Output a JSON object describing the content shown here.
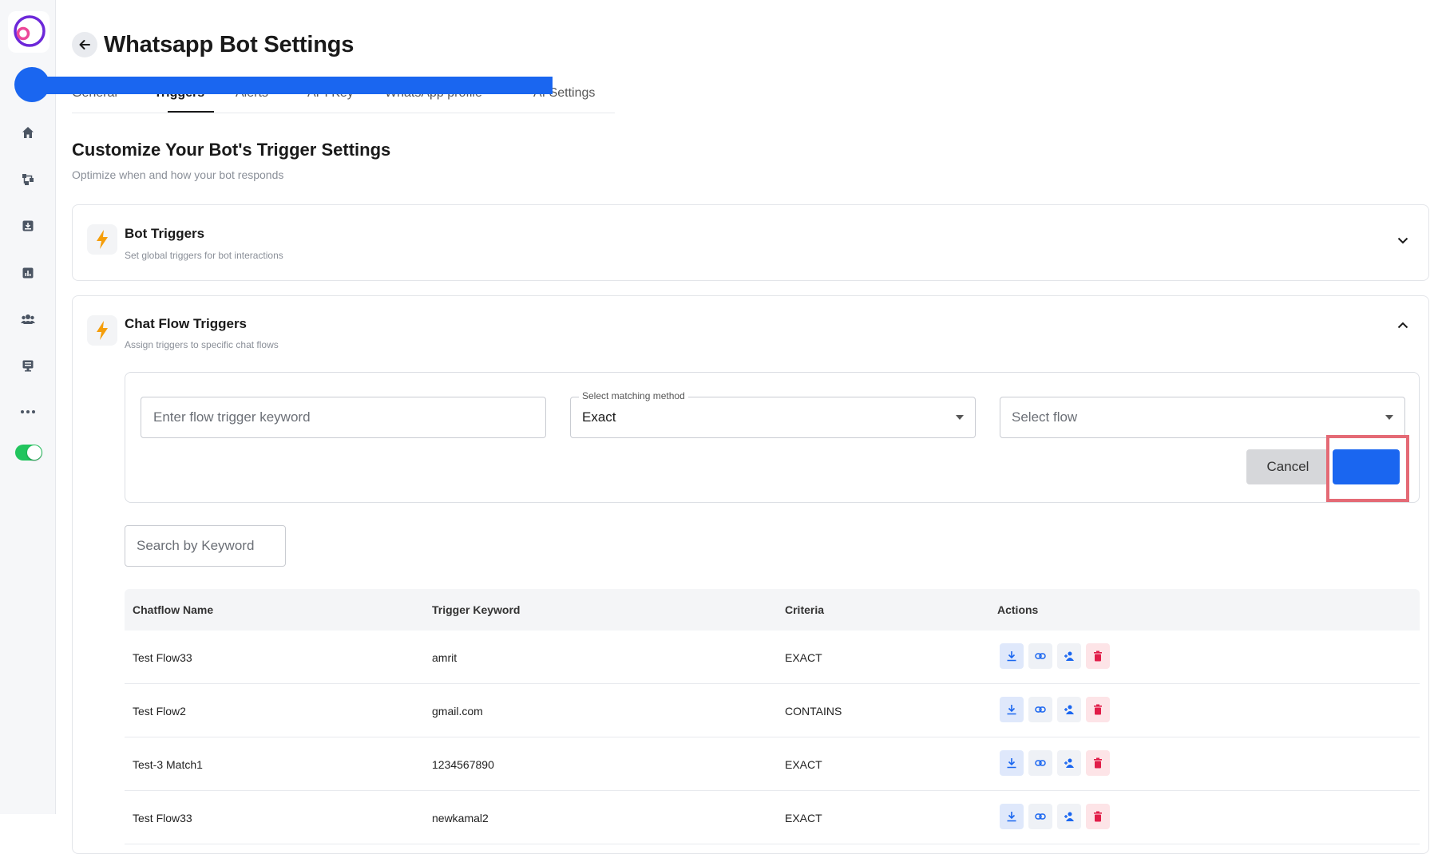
{
  "page": {
    "title": "Whatsapp Bot Settings"
  },
  "tabs": [
    {
      "label": "General"
    },
    {
      "label": "Triggers"
    },
    {
      "label": "Alerts"
    },
    {
      "label": "API Key"
    },
    {
      "label": "WhatsApp profile"
    },
    {
      "label": "AI Settings"
    }
  ],
  "section": {
    "title": "Customize Your Bot's Trigger Settings",
    "subtitle": "Optimize when and how your bot responds"
  },
  "bot_triggers": {
    "title": "Bot Triggers",
    "subtitle": "Set global triggers for bot interactions"
  },
  "chat_flow_triggers": {
    "title": "Chat Flow Triggers",
    "subtitle": "Assign triggers to specific chat flows"
  },
  "form": {
    "keyword_placeholder": "Enter flow trigger keyword",
    "method_legend": "Select matching method",
    "method_value": "Exact",
    "flow_placeholder": "Select flow",
    "cancel_label": "Cancel",
    "save_label": ""
  },
  "search": {
    "placeholder": "Search by Keyword"
  },
  "table": {
    "headers": [
      "Chatflow Name",
      "Trigger Keyword",
      "Criteria",
      "Actions"
    ],
    "rows": [
      {
        "name": "Test Flow33",
        "keyword": "amrit",
        "criteria": "EXACT"
      },
      {
        "name": "Test Flow2",
        "keyword": "gmail.com",
        "criteria": "CONTAINS"
      },
      {
        "name": "Test-3 Match1",
        "keyword": "1234567890",
        "criteria": "EXACT"
      },
      {
        "name": "Test Flow33",
        "keyword": "newkamal2",
        "criteria": "EXACT"
      }
    ]
  },
  "colors": {
    "accent": "#1a66f0",
    "bolt": "#f59e0b",
    "delete": "#e11d48",
    "toggle_on": "#22c55e",
    "highlight": "#e46a75"
  }
}
